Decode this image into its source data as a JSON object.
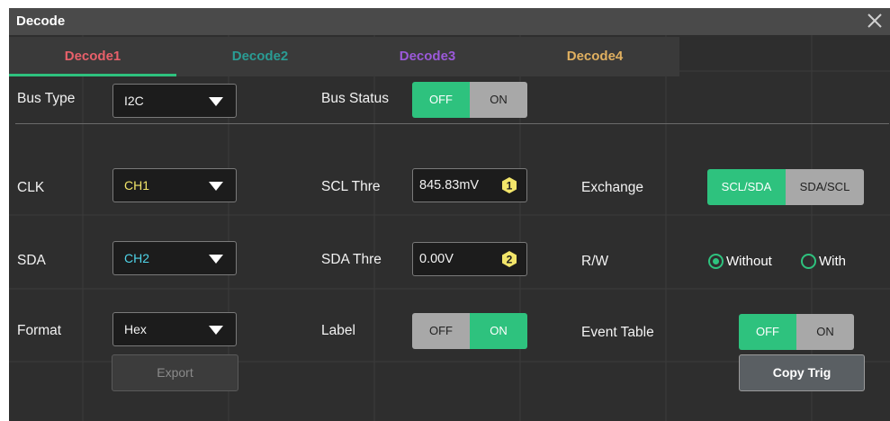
{
  "dialog": {
    "title": "Decode",
    "close_icon": "close-icon"
  },
  "tabs": [
    {
      "label": "Decode1",
      "color": "#e8606a",
      "active": true
    },
    {
      "label": "Decode2",
      "color": "#2a9c94",
      "active": false
    },
    {
      "label": "Decode3",
      "color": "#9b59d9",
      "active": false
    },
    {
      "label": "Decode4",
      "color": "#e0b060",
      "active": false
    }
  ],
  "bus_type": {
    "label": "Bus Type",
    "value": "I2C"
  },
  "bus_status": {
    "label": "Bus Status",
    "off": "OFF",
    "on": "ON",
    "selected": "OFF"
  },
  "clk": {
    "label": "CLK",
    "value": "CH1",
    "color": "#f2e56a"
  },
  "sda": {
    "label": "SDA",
    "value": "CH2",
    "color": "#4fd4e8"
  },
  "scl_thre": {
    "label": "SCL Thre",
    "value": "845.83mV",
    "badge": "1",
    "badge_icon": "hexagon-1-icon"
  },
  "sda_thre": {
    "label": "SDA Thre",
    "value": "0.00V",
    "badge": "2",
    "badge_icon": "hexagon-2-icon"
  },
  "exchange": {
    "label": "Exchange",
    "option1": "SCL/SDA",
    "option2": "SDA/SCL",
    "selected": "SCL/SDA"
  },
  "rw": {
    "label": "R/W",
    "option1": "Without",
    "option2": "With",
    "selected": "Without"
  },
  "format": {
    "label": "Format",
    "value": "Hex"
  },
  "label_toggle": {
    "label": "Label",
    "off": "OFF",
    "on": "ON",
    "selected": "ON"
  },
  "event_table": {
    "label": "Event Table",
    "off": "OFF",
    "on": "ON",
    "selected": "OFF"
  },
  "export": {
    "label": "Export"
  },
  "copy_trig": {
    "label": "Copy Trig"
  },
  "colors": {
    "accent": "#2ec27e",
    "panel": "#2e2e2e",
    "titlebar": "#4a4a4a"
  }
}
